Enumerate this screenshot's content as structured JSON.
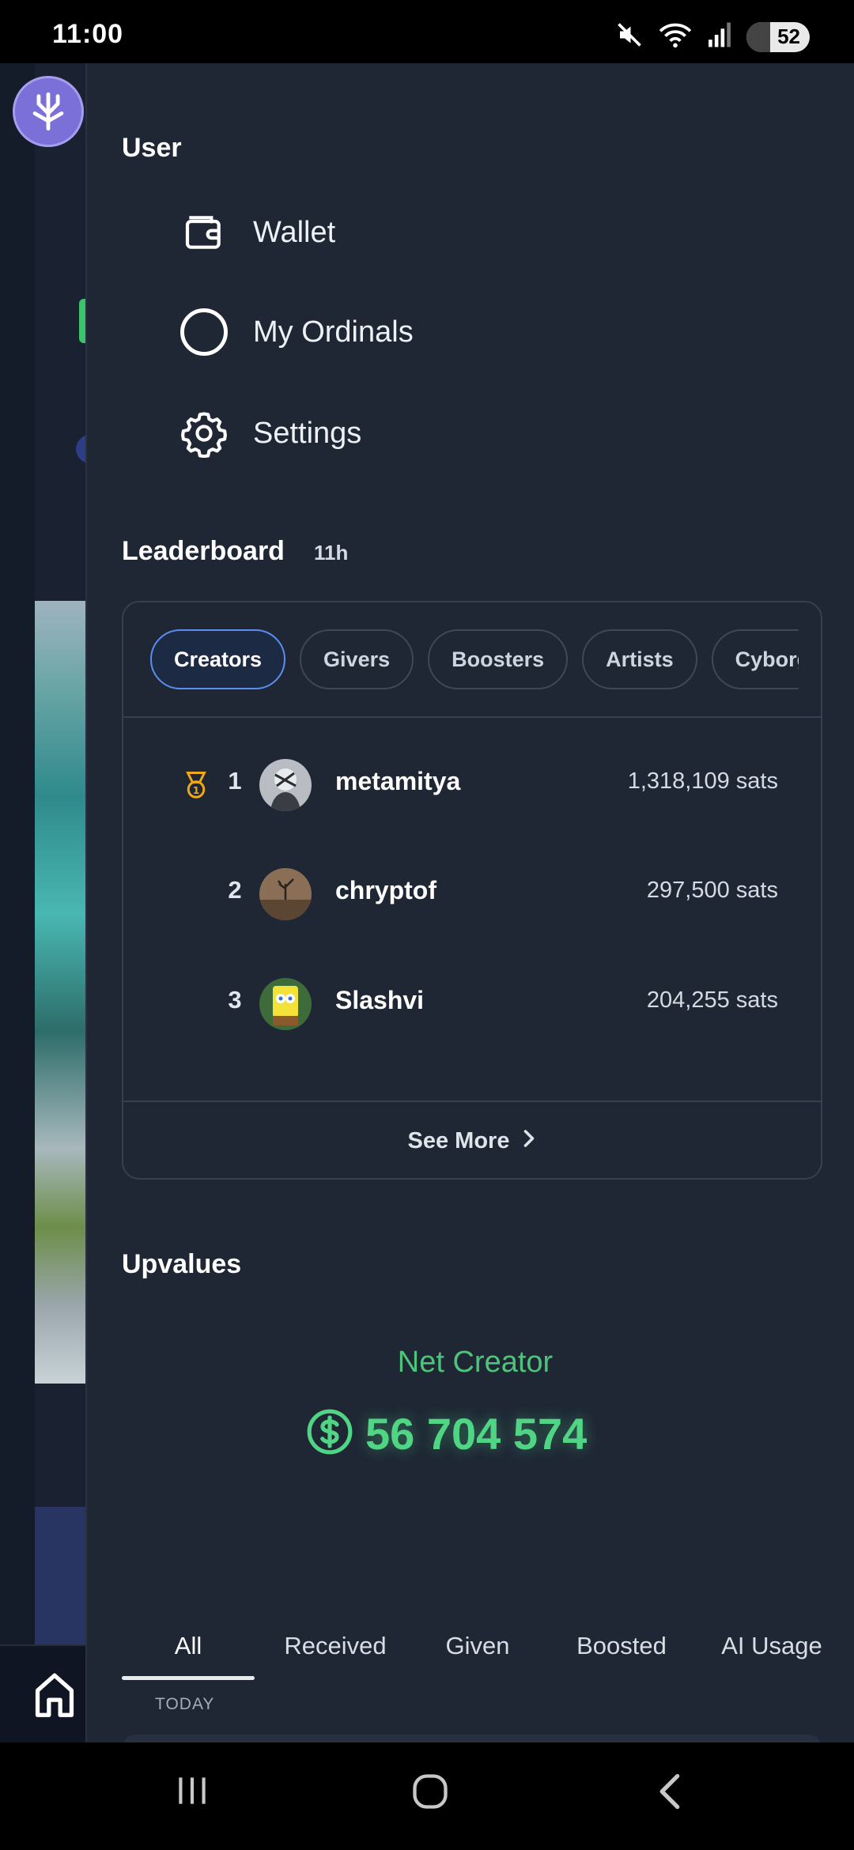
{
  "status_bar": {
    "time": "11:00",
    "battery": "52",
    "icons": [
      "mute-icon",
      "wifi-icon",
      "signal-icon",
      "battery-icon"
    ]
  },
  "drawer": {
    "user_section": {
      "title": "User",
      "items": [
        {
          "label": "Wallet",
          "icon": "wallet-icon"
        },
        {
          "label": "My Ordinals",
          "icon": "circle-icon"
        },
        {
          "label": "Settings",
          "icon": "gear-icon"
        }
      ]
    },
    "leaderboard": {
      "title": "Leaderboard",
      "time_left": "11h",
      "chips": [
        "Creators",
        "Givers",
        "Boosters",
        "Artists",
        "Cyborg"
      ],
      "active_chip": "Creators",
      "rows": [
        {
          "rank": "1",
          "name": "metamitya",
          "sats": "1,318,109 sats",
          "medal": true
        },
        {
          "rank": "2",
          "name": "chryptof",
          "sats": "297,500 sats",
          "medal": false
        },
        {
          "rank": "3",
          "name": "Slashvi",
          "sats": "204,255 sats",
          "medal": false
        }
      ],
      "see_more": "See More"
    },
    "upvalues": {
      "title": "Upvalues",
      "net_label": "Net Creator",
      "net_value": "56 704 574",
      "tabs": [
        "All",
        "Received",
        "Given",
        "Boosted",
        "AI Usage"
      ],
      "active_tab": "All",
      "group_label": "TODAY"
    }
  },
  "colors": {
    "drawer_bg": "#1f2735",
    "accent_green": "#4fd584",
    "chip_active_border": "#5a8ef0",
    "app_logo": "#7b6fd8",
    "medal": "#f0a818"
  }
}
